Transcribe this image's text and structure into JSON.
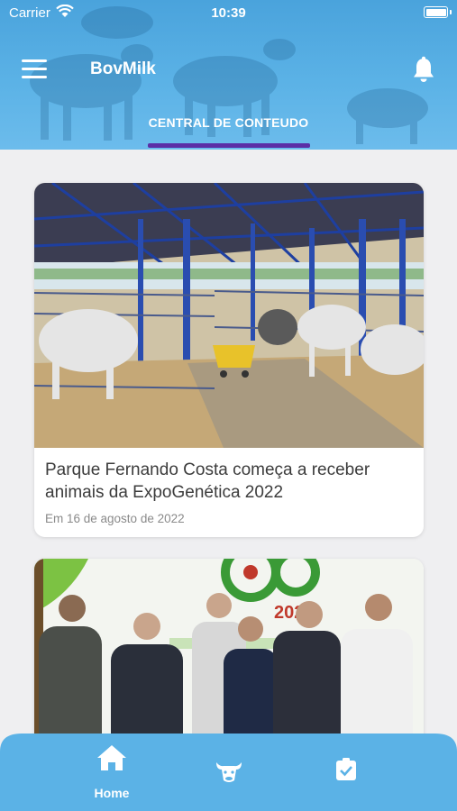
{
  "status_bar": {
    "carrier": "Carrier",
    "time": "10:39"
  },
  "header": {
    "app_title": "BovMilk",
    "tab_label": "CENTRAL DE CONTEUDO"
  },
  "icons": {
    "menu": "hamburger-menu-icon",
    "notifications": "bell-icon",
    "wifi": "wifi-icon",
    "battery": "battery-icon",
    "home": "home-icon",
    "cattle": "cow-head-icon",
    "tasks": "clipboard-check-icon"
  },
  "colors": {
    "header_blue": "#4aa3dc",
    "tab_indicator": "#5b2fa6",
    "nav_blue": "#5bb2e6",
    "background": "#efeff1"
  },
  "news": [
    {
      "title": "Parque Fernando Costa começa a receber animais da ExpoGenética 2022",
      "date": "Em 16 de agosto de 2022"
    },
    {
      "banner_year": "2022"
    }
  ],
  "bottom_nav": {
    "home_label": "Home"
  }
}
